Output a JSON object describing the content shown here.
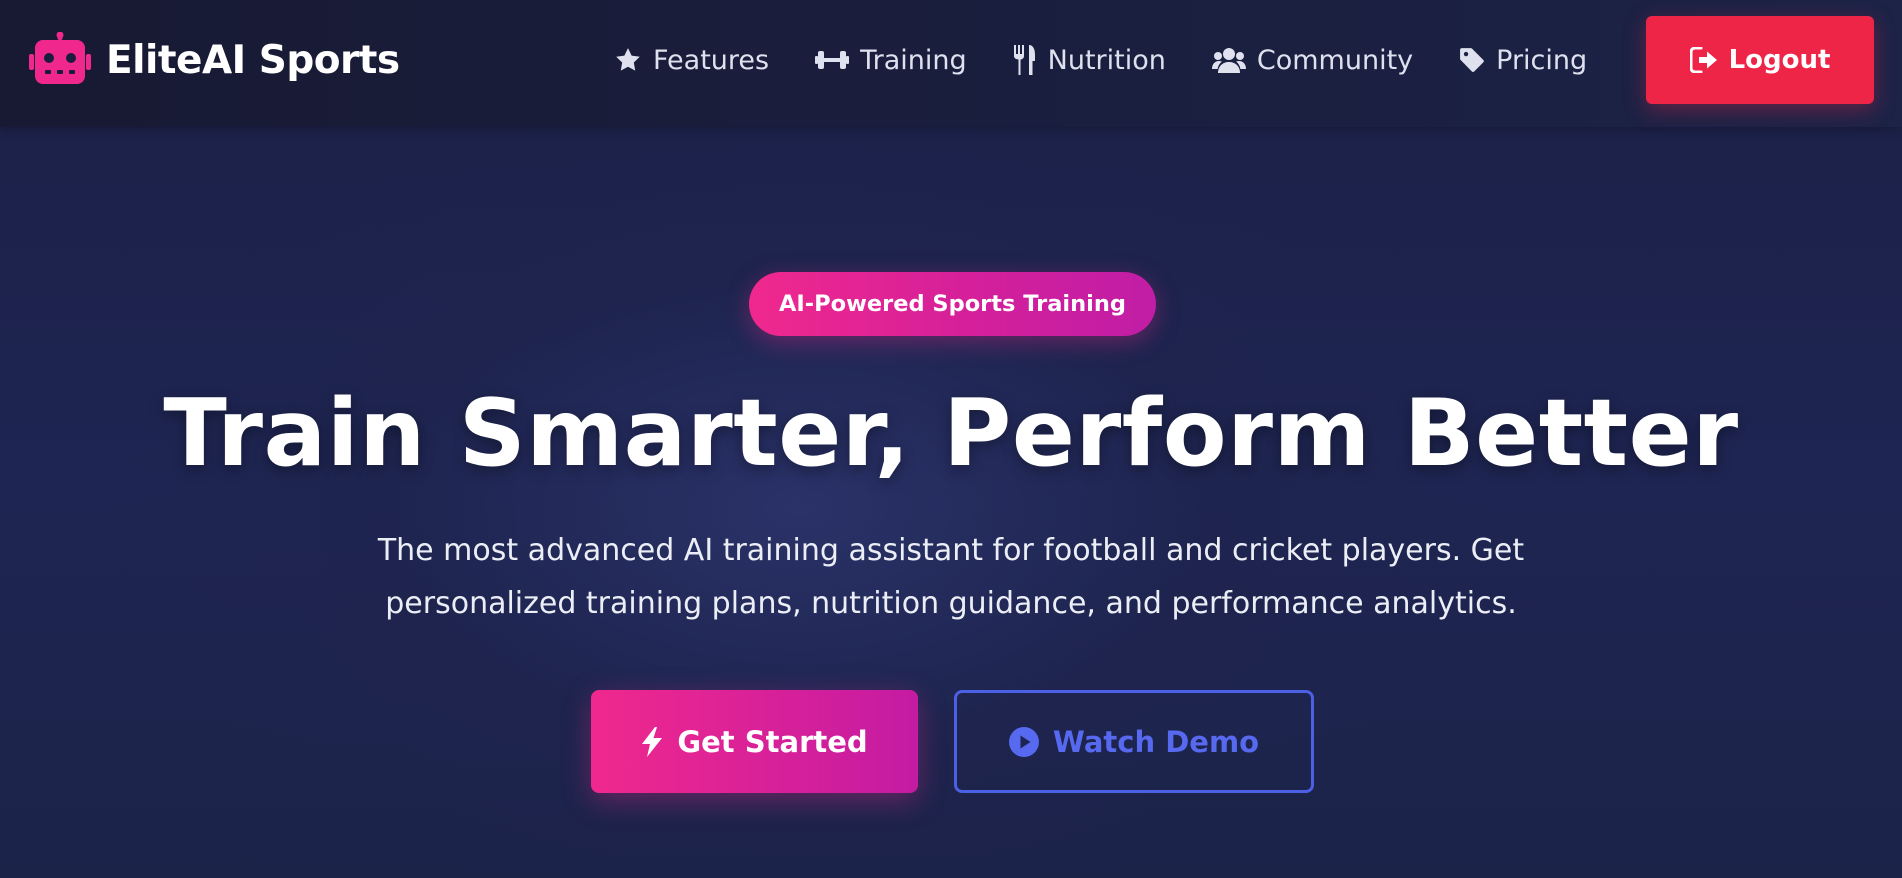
{
  "brand": {
    "name": "EliteAI Sports",
    "icon": "robot-icon",
    "icon_color": "#f0288d"
  },
  "nav": {
    "items": [
      {
        "label": "Features",
        "icon": "star-icon"
      },
      {
        "label": "Training",
        "icon": "dumbbell-icon"
      },
      {
        "label": "Nutrition",
        "icon": "utensils-icon"
      },
      {
        "label": "Community",
        "icon": "users-icon"
      },
      {
        "label": "Pricing",
        "icon": "tag-icon"
      }
    ],
    "logout_label": "Logout",
    "logout_icon": "sign-out-icon",
    "logout_color": "#ee2547"
  },
  "hero": {
    "badge": "AI-Powered Sports Training",
    "title": "Train Smarter, Perform Better",
    "subtitle_line1": "The most advanced AI training assistant for football and cricket players. Get",
    "subtitle_line2": "personalized training plans, nutrition guidance, and performance analytics.",
    "primary_cta": {
      "label": "Get Started",
      "icon": "bolt-icon"
    },
    "secondary_cta": {
      "label": "Watch Demo",
      "icon": "play-circle-icon"
    }
  },
  "colors": {
    "accent_pink": "#f0288d",
    "accent_purple": "#c41ba3",
    "accent_blue": "#4c60e6",
    "background": "#1e2552"
  }
}
